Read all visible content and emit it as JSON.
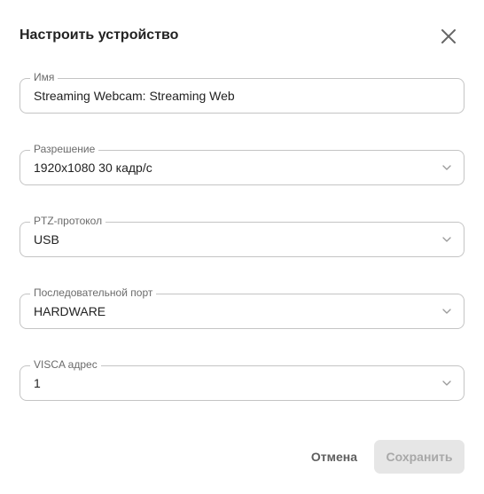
{
  "dialog": {
    "title": "Настроить устройство",
    "close_icon": "close-icon"
  },
  "fields": {
    "name": {
      "label": "Имя",
      "value": "Streaming Webcam: Streaming Web"
    },
    "resolution": {
      "label": "Разрешение",
      "value": "1920x1080 30 кадр/с",
      "icon": "chevron-down-icon"
    },
    "ptz_protocol": {
      "label": "PTZ-протокол",
      "value": "USB",
      "icon": "chevron-down-icon"
    },
    "serial_port": {
      "label": "Последовательной порт",
      "value": "HARDWARE",
      "icon": "chevron-down-icon"
    },
    "visca_address": {
      "label": "VISCA адрес",
      "value": "1",
      "icon": "chevron-down-icon"
    }
  },
  "actions": {
    "cancel_label": "Отмена",
    "save_label": "Сохранить",
    "save_enabled": false
  },
  "colors": {
    "border": "#c4c4c4",
    "label": "#6b6b6b",
    "text": "#222222",
    "save_bg_disabled": "#e6e6e6",
    "save_text_disabled": "#a8a8a8"
  }
}
